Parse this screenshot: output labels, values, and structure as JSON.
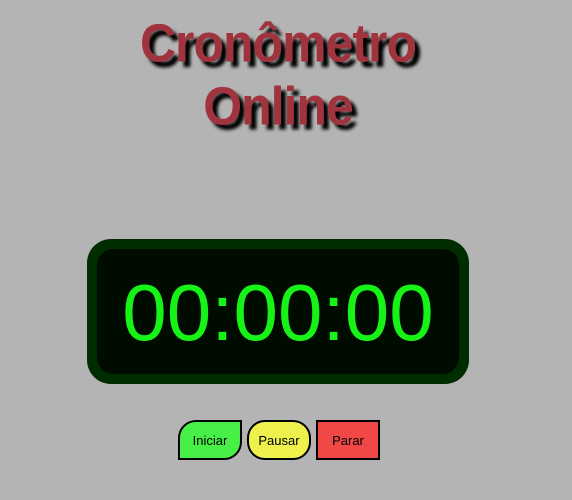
{
  "title": {
    "line1": "Cronômetro",
    "line2": "Online"
  },
  "clock": {
    "display": "00:00:00"
  },
  "buttons": {
    "start": "Iniciar",
    "pause": "Pausar",
    "stop": "Parar"
  },
  "colors": {
    "background": "#b4b4b4",
    "title": "#a0343e",
    "clock_digits": "#17f317",
    "start_button": "#47f047",
    "pause_button": "#eef04c",
    "stop_button": "#f04747"
  }
}
